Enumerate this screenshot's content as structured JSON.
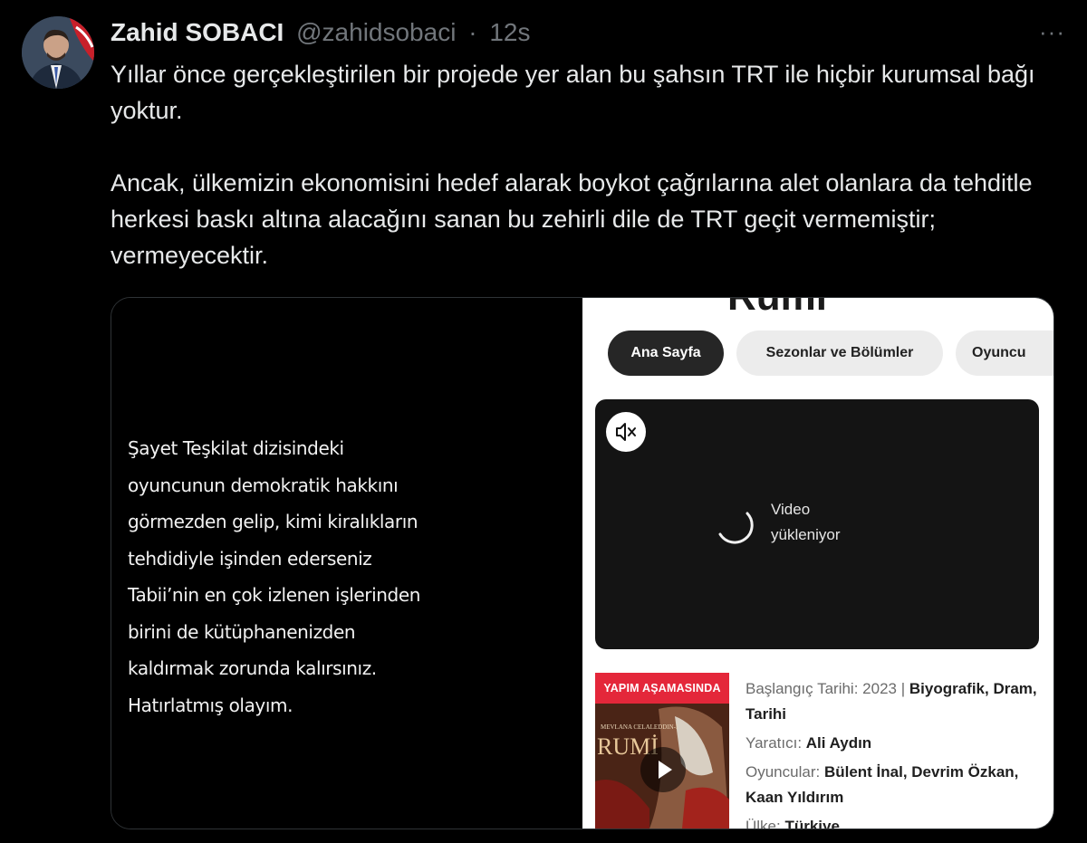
{
  "tweet": {
    "author_name": "Zahid SOBACI",
    "handle": "@zahidsobaci",
    "separator": "·",
    "time": "12s",
    "more_label": "···",
    "paragraphs": [
      "Yıllar önce gerçekleştirilen bir projede yer alan bu şahsın TRT ile hiçbir kurumsal bağı yoktur.",
      "Ancak, ülkemizin ekonomisini hedef alarak boykot çağrılarına alet olanlara da tehditle herkesi baskı altına alacağını sanan bu zehirli dile de TRT geçit vermemiştir; vermeyecektir."
    ]
  },
  "media": {
    "left_quote_lines": [
      "Şayet Teşkilat dizisindeki",
      "oyuncunun demokratik hakkını",
      "görmezden gelip, kimi kiralıkların",
      "tehdidiyle işinden ederseniz",
      "Tabii’nin en çok izlenen işlerinden",
      "birini de kütüphanenizden",
      "kaldırmak zorunda kalırsınız.",
      "Hatırlatmış olayım."
    ],
    "right": {
      "cut_title": "Rumi",
      "tabs": [
        "Ana Sayfa",
        "Sezonlar ve Bölümler",
        "Oyuncu"
      ],
      "video_label_line1": "Video",
      "video_label_line2": "yükleniyor",
      "mute_icon": "speaker-muted-icon",
      "poster_badge": "YAPIM AŞAMASINDA",
      "poster_subtitle": "MEVLANA CELALEDDIN-İ",
      "poster_title": "RUMİ",
      "info": {
        "start_label": "Başlangıç Tarihi:",
        "start_value": "2023",
        "sep": "|",
        "genres": "Biyografik, Dram, Tarihi",
        "creator_label": "Yaratıcı:",
        "creator": "Ali Aydın",
        "cast_label": "Oyuncular:",
        "cast": "Bülent İnal, Devrim Özkan, Kaan Yıldırım",
        "country_label": "Ülke:",
        "country": "Türkiye"
      }
    }
  },
  "colors": {
    "background": "#000000",
    "text": "#e7e9ea",
    "muted": "#71767b",
    "badge": "#e4273a"
  }
}
